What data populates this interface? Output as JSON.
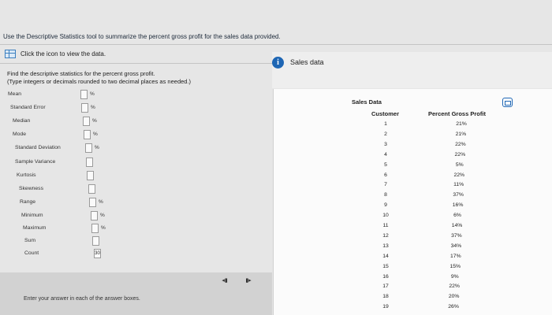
{
  "question": "Use the Descriptive Statistics tool to summarize the percent gross profit for the sales data provided.",
  "data_link": {
    "text": "Click the icon to view the data."
  },
  "instructions": {
    "line1": "Find the descriptive statistics for the percent gross profit.",
    "line2": "(Type integers or decimals rounded to two decimal places as needed.)"
  },
  "stats": [
    {
      "label": "Mean",
      "value": "",
      "unit": "%"
    },
    {
      "label": "Standard Error",
      "value": "",
      "unit": "%"
    },
    {
      "label": "Median",
      "value": "",
      "unit": "%"
    },
    {
      "label": "Mode",
      "value": "",
      "unit": "%"
    },
    {
      "label": "Standard Deviation",
      "value": "",
      "unit": "%"
    },
    {
      "label": "Sample Variance",
      "value": "",
      "unit": ""
    },
    {
      "label": "Kurtosis",
      "value": "",
      "unit": ""
    },
    {
      "label": "Skewness",
      "value": "",
      "unit": ""
    },
    {
      "label": "Range",
      "value": "",
      "unit": "%"
    },
    {
      "label": "Minimum",
      "value": "",
      "unit": "%"
    },
    {
      "label": "Maximum",
      "value": "",
      "unit": "%"
    },
    {
      "label": "Sum",
      "value": "",
      "unit": ""
    },
    {
      "label": "Count",
      "value": "30",
      "unit": ""
    }
  ],
  "footer": {
    "message": "Enter your answer in each of the answer boxes."
  },
  "popup": {
    "title": "Sales data",
    "sheet_title": "Sales Data",
    "columns": [
      "Customer",
      "Percent Gross Profit"
    ],
    "rows": [
      [
        "1",
        "21%"
      ],
      [
        "2",
        "21%"
      ],
      [
        "3",
        "22%"
      ],
      [
        "4",
        "22%"
      ],
      [
        "5",
        "5%"
      ],
      [
        "6",
        "22%"
      ],
      [
        "7",
        "11%"
      ],
      [
        "8",
        "37%"
      ],
      [
        "9",
        "16%"
      ],
      [
        "10",
        "6%"
      ],
      [
        "11",
        "14%"
      ],
      [
        "12",
        "37%"
      ],
      [
        "13",
        "34%"
      ],
      [
        "14",
        "17%"
      ],
      [
        "15",
        "15%"
      ],
      [
        "16",
        "9%"
      ],
      [
        "17",
        "22%"
      ],
      [
        "18",
        "20%"
      ],
      [
        "19",
        "26%"
      ]
    ]
  },
  "colors": {
    "accent": "#1e66b4",
    "background": "#e6e6e6"
  }
}
